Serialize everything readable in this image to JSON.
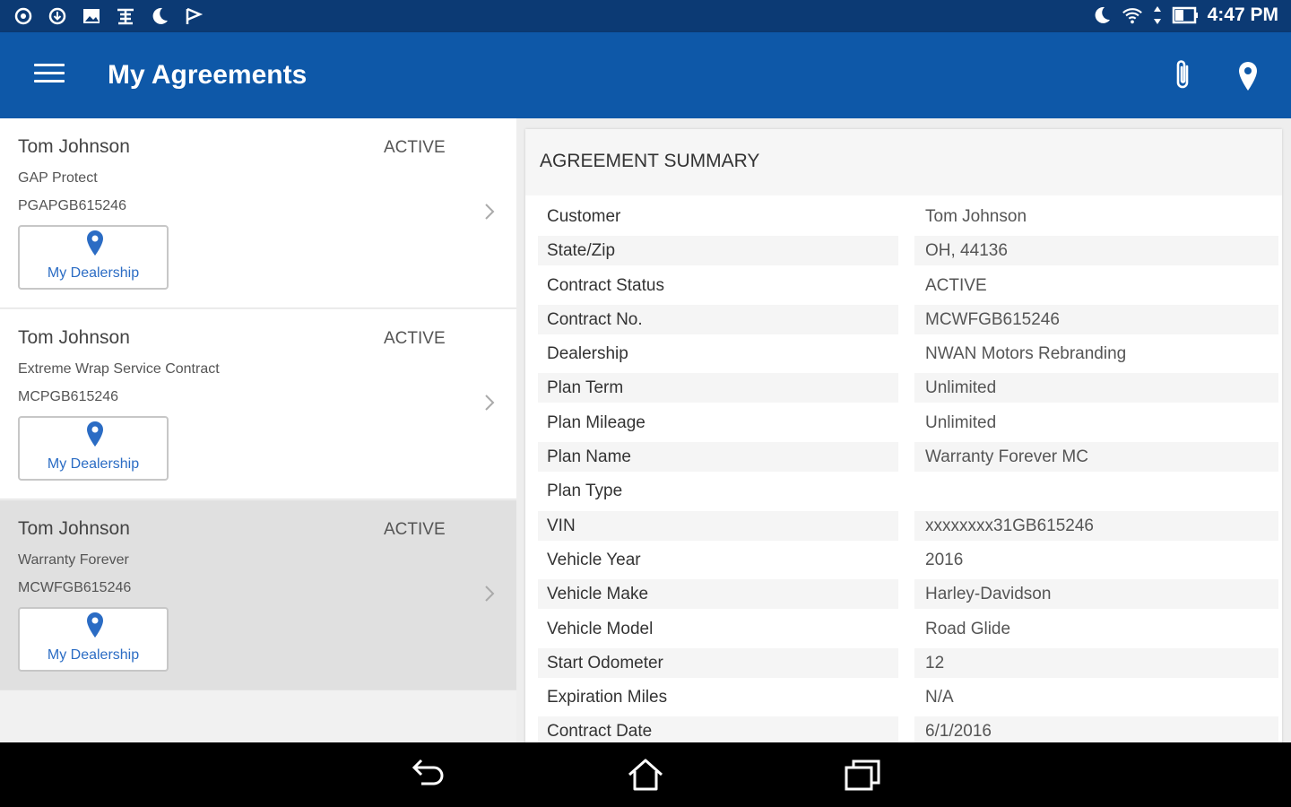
{
  "status_bar": {
    "time": "4:47 PM",
    "left_icons": [
      "sync-icon",
      "download-icon",
      "image-icon",
      "cast-icon",
      "moon-icon",
      "flag-icon"
    ],
    "right_icons": [
      "do-not-disturb-moon-icon",
      "wifi-icon",
      "data-arrows-icon",
      "battery-icon"
    ]
  },
  "app_bar": {
    "title": "My Agreements",
    "menu_icon": "hamburger-menu-icon",
    "actions": [
      "attachment-icon",
      "location-pin-icon"
    ],
    "color": "#0e58a8"
  },
  "agreements": [
    {
      "name": "Tom  Johnson",
      "status": "ACTIVE",
      "plan": "GAP Protect",
      "contract": "PGAPGB615246",
      "dealer_label": "My Dealership",
      "selected": false
    },
    {
      "name": "Tom  Johnson",
      "status": "ACTIVE",
      "plan": "Extreme Wrap Service Contract",
      "contract": "MCPGB615246",
      "dealer_label": "My Dealership",
      "selected": false
    },
    {
      "name": "Tom  Johnson",
      "status": "ACTIVE",
      "plan": "Warranty Forever",
      "contract": "MCWFGB615246",
      "dealer_label": "My Dealership",
      "selected": true
    }
  ],
  "summary": {
    "title": "AGREEMENT SUMMARY",
    "rows": [
      {
        "label": "Customer",
        "value": "Tom Johnson"
      },
      {
        "label": "State/Zip",
        "value": "OH, 44136"
      },
      {
        "label": "Contract Status",
        "value": "ACTIVE"
      },
      {
        "label": "Contract No.",
        "value": "MCWFGB615246"
      },
      {
        "label": "Dealership",
        "value": "NWAN Motors Rebranding"
      },
      {
        "label": "Plan Term",
        "value": "Unlimited"
      },
      {
        "label": "Plan Mileage",
        "value": "Unlimited"
      },
      {
        "label": "Plan Name",
        "value": "Warranty Forever MC"
      },
      {
        "label": "Plan Type",
        "value": ""
      },
      {
        "label": "VIN",
        "value": "xxxxxxxx31GB615246"
      },
      {
        "label": "Vehicle Year",
        "value": "2016"
      },
      {
        "label": "Vehicle Make",
        "value": "Harley-Davidson"
      },
      {
        "label": "Vehicle Model",
        "value": "Road Glide"
      },
      {
        "label": "Start Odometer",
        "value": "12"
      },
      {
        "label": "Expiration Miles",
        "value": "N/A"
      },
      {
        "label": "Contract Date",
        "value": "6/1/2016"
      }
    ]
  },
  "nav_bar": {
    "buttons": [
      "back-icon",
      "home-icon",
      "recent-apps-icon"
    ]
  },
  "colors": {
    "status_bar": "#0c3a74",
    "app_bar": "#0e58a8",
    "link": "#2b6cc4",
    "selected_row": "#e0e0e0"
  }
}
